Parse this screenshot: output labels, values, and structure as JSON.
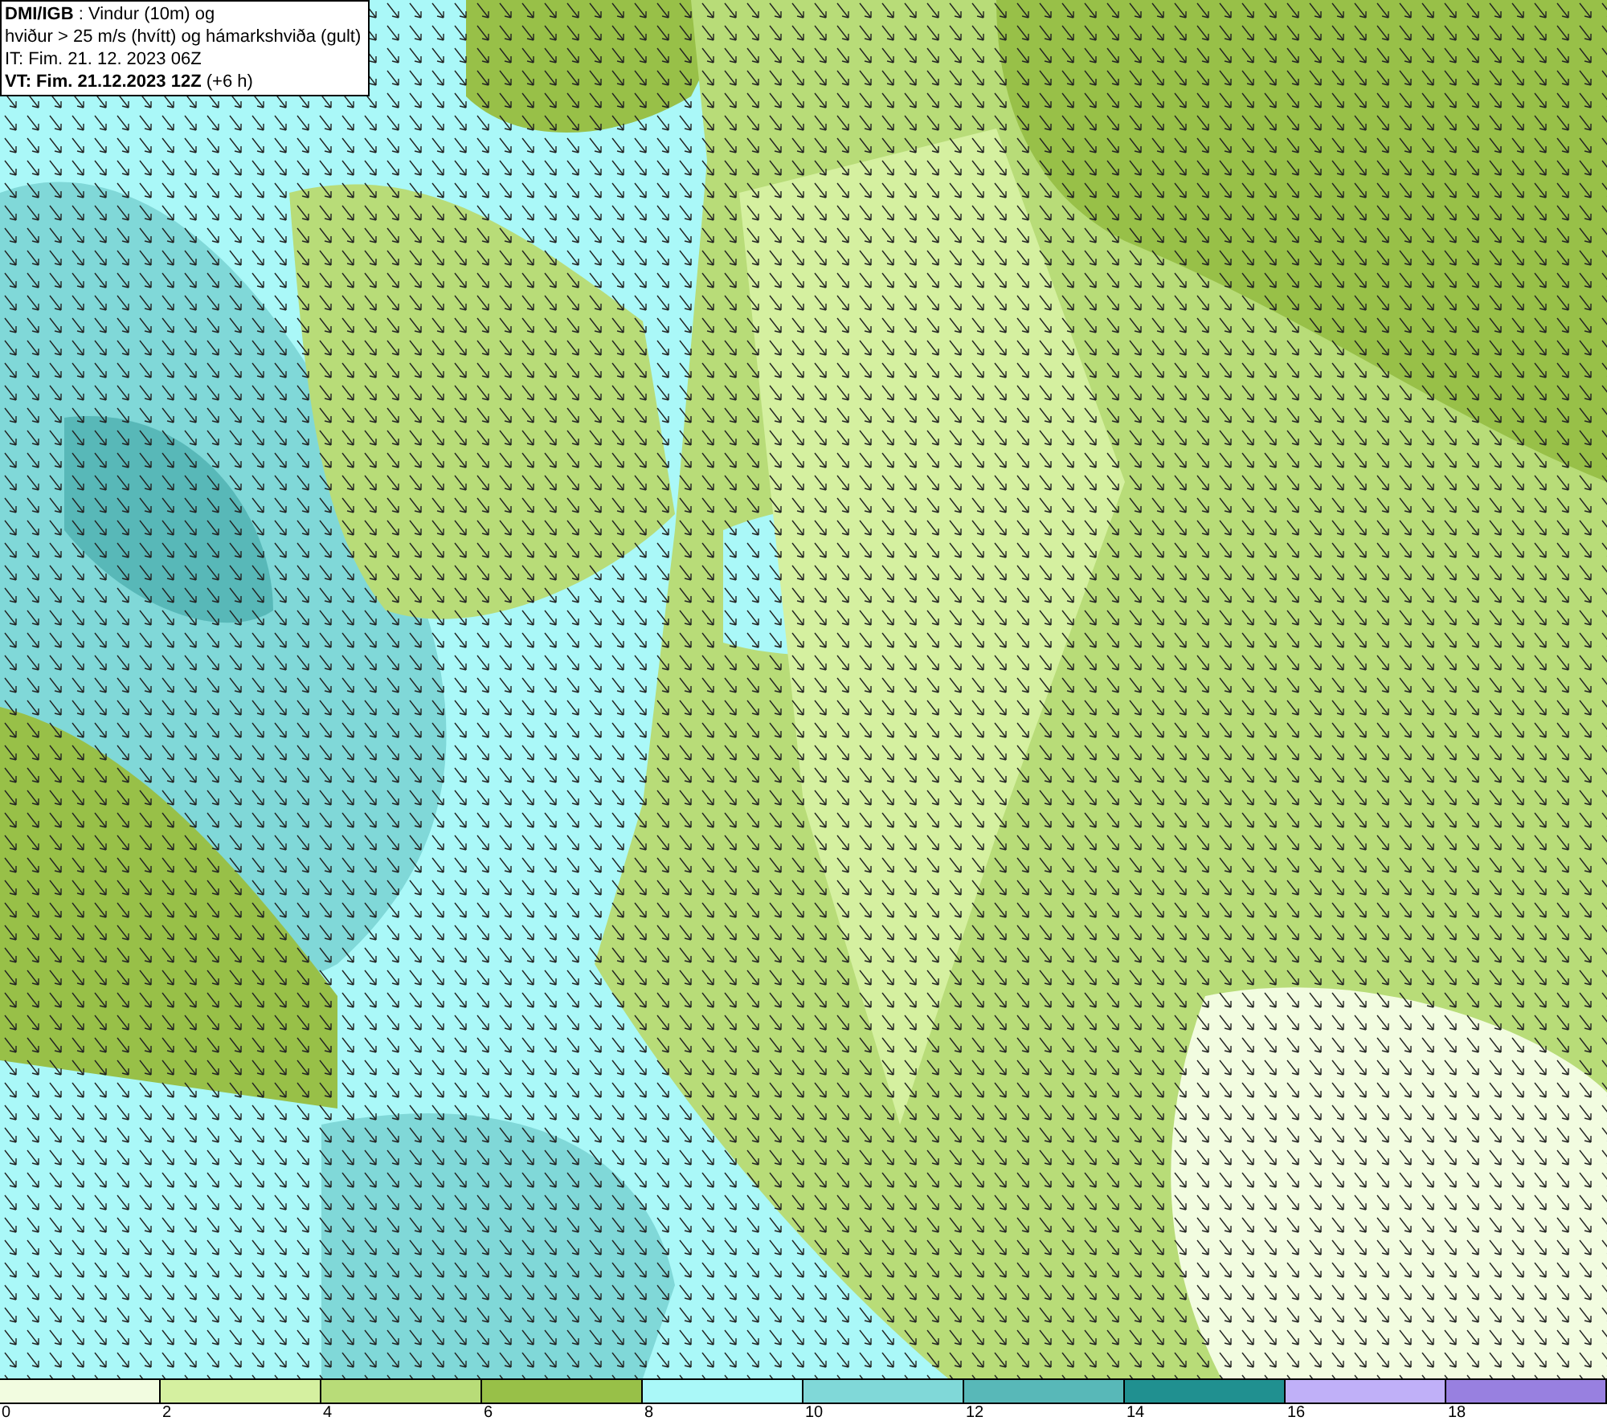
{
  "header": {
    "lines": [
      "**DMI/IGB** : Vindur (10m) og",
      "hviður > 25 m/s (hvítt) og hámarkshviða (gult)",
      "IT: Fim. 21. 12. 2023 06Z",
      "**VT: Fim. 21.12.2023 12Z** (+6 h)"
    ]
  },
  "legend": {
    "bins": [
      {
        "color": "#f2fce0"
      },
      {
        "color": "#d5f0a0"
      },
      {
        "color": "#b8dc78"
      },
      {
        "color": "#98c048"
      },
      {
        "color": "#aaf8f8"
      },
      {
        "color": "#80d8d8"
      },
      {
        "color": "#58b8b8"
      },
      {
        "color": "#209090"
      },
      {
        "color": "#c0b0f8"
      },
      {
        "color": "#9880e0"
      }
    ],
    "labels": [
      "0",
      "2",
      "4",
      "6",
      "8",
      "10",
      "12",
      "14",
      "16",
      "18"
    ]
  }
}
